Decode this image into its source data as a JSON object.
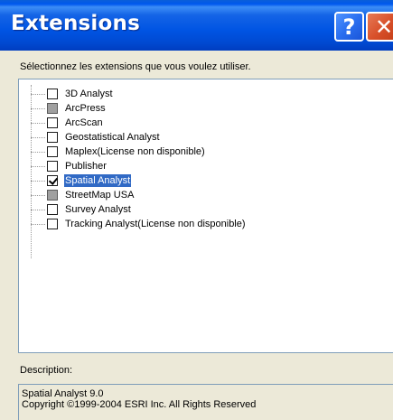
{
  "window": {
    "title": "Extensions",
    "help_glyph": "?",
    "close_glyph": "✕"
  },
  "instruction": "Sélectionnez les extensions que vous voulez utiliser.",
  "extensions": [
    {
      "label": "3D Analyst",
      "state": "unchecked"
    },
    {
      "label": "ArcPress",
      "state": "disabled"
    },
    {
      "label": "ArcScan",
      "state": "unchecked"
    },
    {
      "label": "Geostatistical Analyst",
      "state": "unchecked"
    },
    {
      "label": "Maplex(License non disponible)",
      "state": "unchecked"
    },
    {
      "label": "Publisher",
      "state": "unchecked"
    },
    {
      "label": "Spatial Analyst",
      "state": "checked",
      "selected": true
    },
    {
      "label": "StreetMap USA",
      "state": "disabled"
    },
    {
      "label": "Survey Analyst",
      "state": "unchecked"
    },
    {
      "label": "Tracking Analyst(License non disponible)",
      "state": "unchecked"
    }
  ],
  "description": {
    "label": "Description:",
    "line1": "Spatial Analyst 9.0",
    "line2": "Copyright ©1999-2004 ESRI Inc. All Rights Reserved"
  },
  "colors": {
    "titlebar": "#0054e3",
    "selection": "#316ac5",
    "dialog_bg": "#ece9d8"
  }
}
